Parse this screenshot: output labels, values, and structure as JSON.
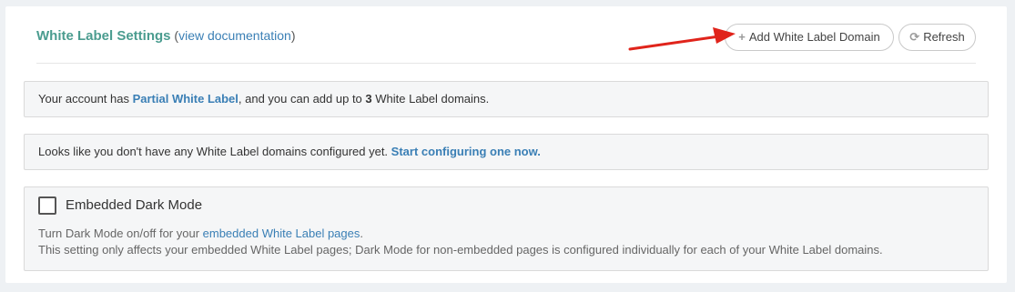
{
  "header": {
    "title": "White Label Settings",
    "paren_open": "(",
    "doc_link": "view documentation",
    "paren_close": ")",
    "add_button": "Add White Label Domain",
    "refresh_button": "Refresh"
  },
  "account_info": {
    "prefix": "Your account has ",
    "plan": "Partial White Label",
    "middle": ", and you can add up to ",
    "count": "3",
    "suffix": " White Label domains."
  },
  "empty_state": {
    "text": "Looks like you don't have any White Label domains configured yet. ",
    "link": "Start configuring one now."
  },
  "dark_mode": {
    "label": "Embedded Dark Mode",
    "checked": false,
    "line1_prefix": "Turn Dark Mode on/off for your ",
    "line1_link": "embedded White Label pages",
    "line1_suffix": ".",
    "line2": "This setting only affects your embedded White Label pages; Dark Mode for non-embedded pages is configured individually for each of your White Label domains."
  },
  "colors": {
    "title": "#4a9c8f",
    "link": "#3a7fb5",
    "arrow": "#e0241b",
    "background": "#eef1f4"
  }
}
